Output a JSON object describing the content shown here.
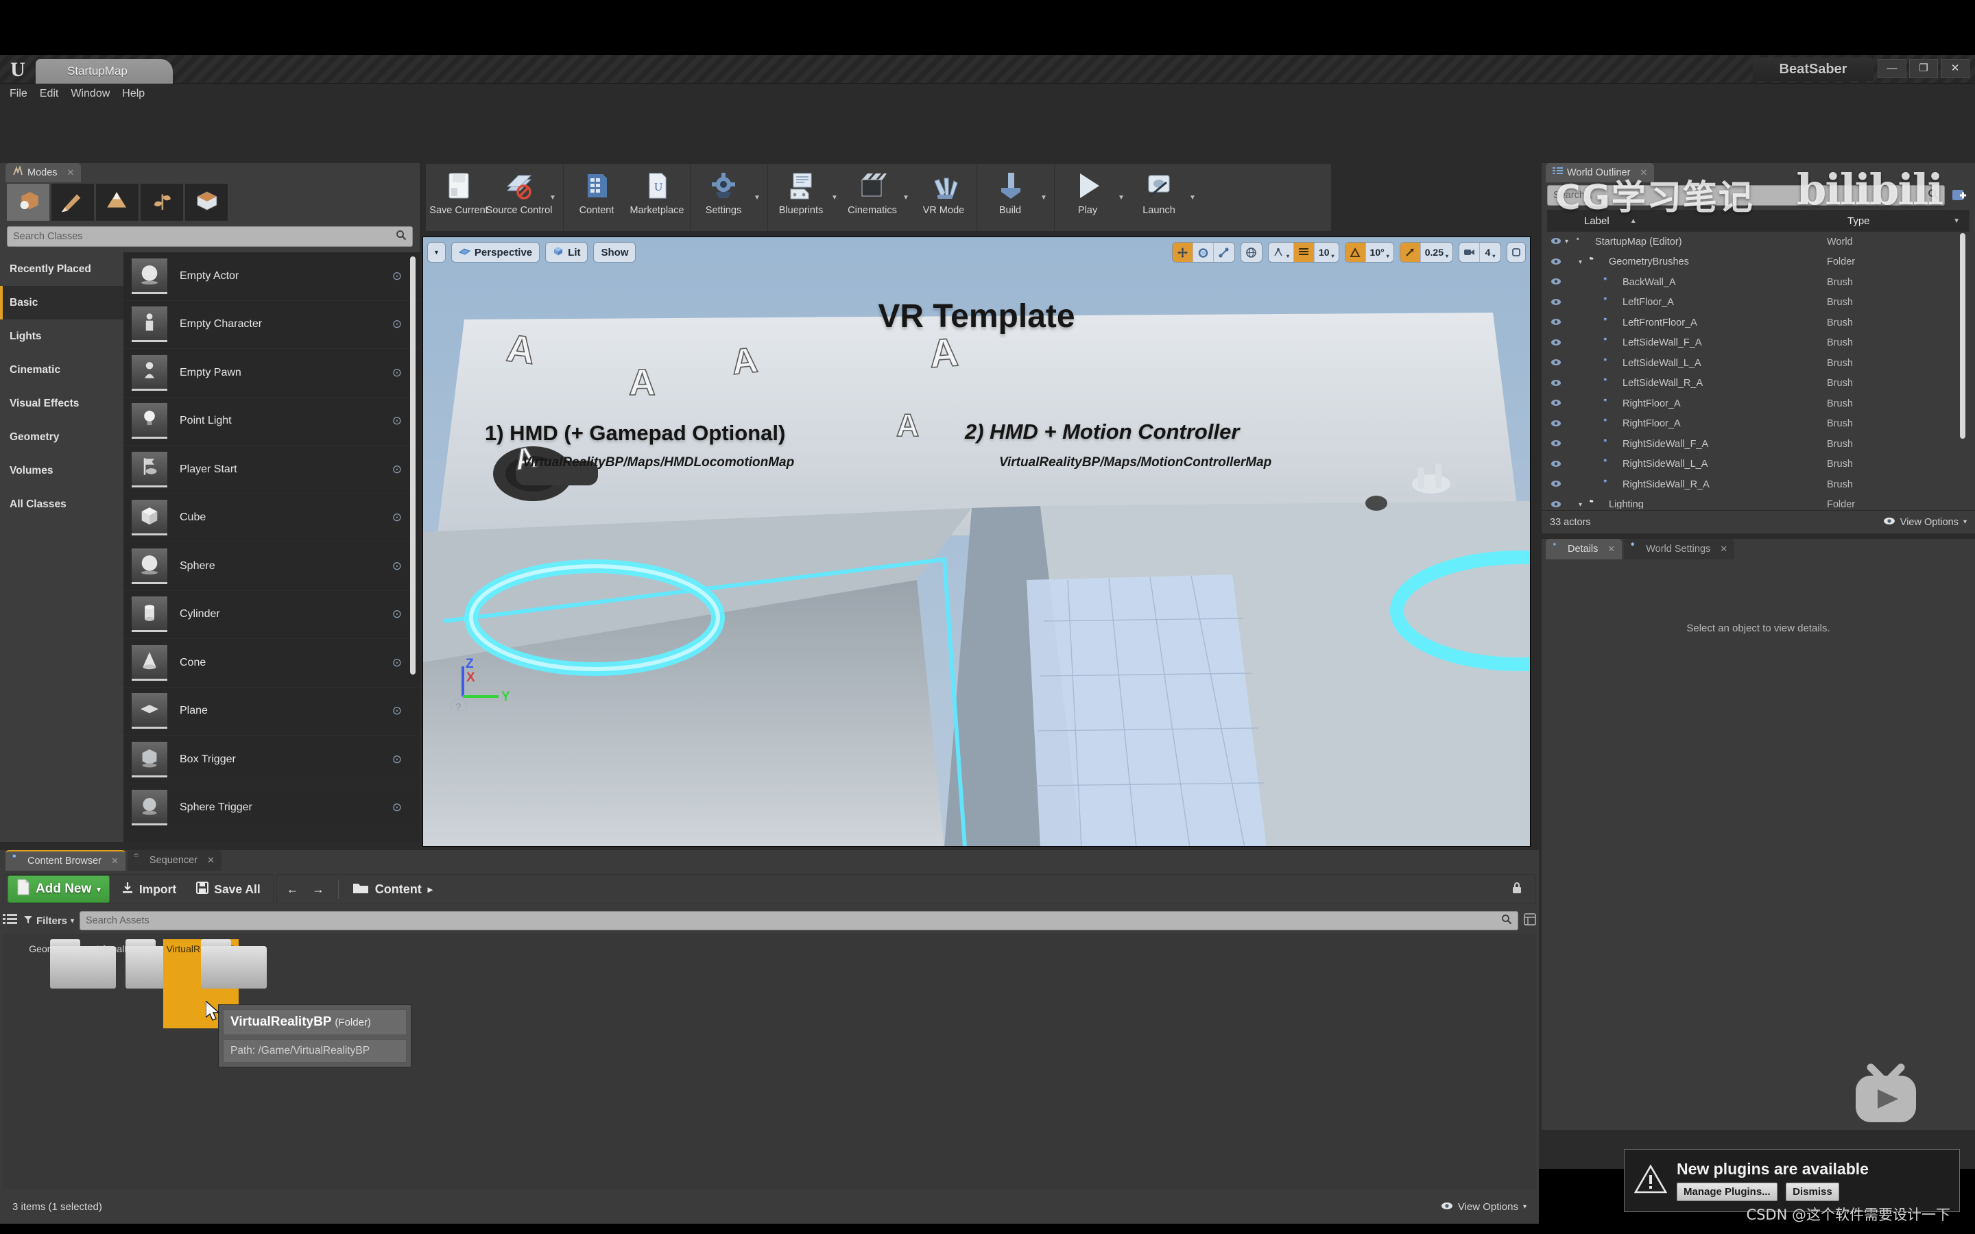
{
  "window": {
    "map_tab": "StartupMap",
    "project_name": "BeatSaber",
    "minimize": "—",
    "maximize": "❐",
    "close": "✕"
  },
  "menu": {
    "items": [
      "File",
      "Edit",
      "Window",
      "Help"
    ]
  },
  "toolbar": {
    "groups": [
      {
        "items": [
          {
            "label": "Save Current",
            "icon": "save-icon",
            "caret": false
          },
          {
            "label": "Source Control",
            "icon": "source-control-icon",
            "caret": true
          }
        ]
      },
      {
        "items": [
          {
            "label": "Content",
            "icon": "content-icon",
            "caret": false
          },
          {
            "label": "Marketplace",
            "icon": "marketplace-icon",
            "caret": false
          }
        ]
      },
      {
        "items": [
          {
            "label": "Settings",
            "icon": "gear-icon",
            "caret": true
          }
        ]
      },
      {
        "items": [
          {
            "label": "Blueprints",
            "icon": "blueprints-icon",
            "caret": true
          },
          {
            "label": "Cinematics",
            "icon": "cinematics-icon",
            "caret": true
          },
          {
            "label": "VR Mode",
            "icon": "vr-mode-icon",
            "caret": false
          }
        ]
      },
      {
        "items": [
          {
            "label": "Build",
            "icon": "build-icon",
            "caret": true
          }
        ]
      },
      {
        "items": [
          {
            "label": "Play",
            "icon": "play-icon",
            "caret": true
          },
          {
            "label": "Launch",
            "icon": "launch-icon",
            "caret": true
          }
        ]
      }
    ]
  },
  "modes": {
    "tab_label": "Modes",
    "tab_close": "✕",
    "mode_buttons": [
      "place-mode-icon",
      "paint-mode-icon",
      "landscape-mode-icon",
      "foliage-mode-icon",
      "geometry-editing-mode-icon"
    ],
    "search_placeholder": "Search Classes",
    "categories": [
      {
        "label": "Recently Placed",
        "active": false
      },
      {
        "label": "Basic",
        "active": true
      },
      {
        "label": "Lights",
        "active": false
      },
      {
        "label": "Cinematic",
        "active": false
      },
      {
        "label": "Visual Effects",
        "active": false
      },
      {
        "label": "Geometry",
        "active": false
      },
      {
        "label": "Volumes",
        "active": false
      },
      {
        "label": "All Classes",
        "active": false
      }
    ],
    "classes": [
      {
        "label": "Empty Actor",
        "icon": "sphere-thumb"
      },
      {
        "label": "Empty Character",
        "icon": "character-thumb"
      },
      {
        "label": "Empty Pawn",
        "icon": "pawn-thumb"
      },
      {
        "label": "Point Light",
        "icon": "point-light-thumb"
      },
      {
        "label": "Player Start",
        "icon": "player-start-thumb"
      },
      {
        "label": "Cube",
        "icon": "cube-thumb"
      },
      {
        "label": "Sphere",
        "icon": "sphere-thumb"
      },
      {
        "label": "Cylinder",
        "icon": "cylinder-thumb"
      },
      {
        "label": "Cone",
        "icon": "cone-thumb"
      },
      {
        "label": "Plane",
        "icon": "plane-thumb"
      },
      {
        "label": "Box Trigger",
        "icon": "box-trigger-thumb"
      },
      {
        "label": "Sphere Trigger",
        "icon": "sphere-trigger-thumb"
      }
    ],
    "help_icon": "?"
  },
  "viewport": {
    "menu_caret": "▼",
    "view_mode": "Perspective",
    "lighting_mode": "Lit",
    "show_label": "Show",
    "transform_tools": [
      "translate-tool",
      "rotate-tool",
      "scale-tool"
    ],
    "coordinate_system": "world-space-icon",
    "surface_snap_icon": "surface-snapping-icon",
    "grid_snap_icon": "grid-snap-icon",
    "grid_snap_value": "10",
    "rotation_snap_icon": "rotation-snap-icon",
    "rotation_snap_value": "10°",
    "scale_snap_icon": "scale-snap-icon",
    "scale_snap_value": "0.25",
    "camera_speed_icon": "camera-speed-icon",
    "camera_speed_value": "4",
    "maximize_icon": "maximize-viewport-icon",
    "gizmo_axes": [
      "Z",
      "X",
      "Y"
    ],
    "scene_text": {
      "title": "VR Template",
      "left_heading": "1) HMD (+ Gamepad Optional)",
      "left_path": "VirtualRealityBP/Maps/HMDLocomotionMap",
      "right_heading": "2) HMD + Motion Controller",
      "right_path": "VirtualRealityBP/Maps/MotionControllerMap"
    }
  },
  "outliner": {
    "tab_label": "World Outliner",
    "tab_close": "✕",
    "search_placeholder": "Search...",
    "add_icon": "add-actor-icon",
    "columns": {
      "label": "Label",
      "type": "Type"
    },
    "sort_caret": "▲",
    "type_caret": "▼",
    "rows": [
      {
        "label": "StartupMap (Editor)",
        "type": "World",
        "depth": 0,
        "icon": "world-icon",
        "expander": "▾"
      },
      {
        "label": "GeometryBrushes",
        "type": "Folder",
        "depth": 1,
        "icon": "folder-icon",
        "expander": "▾"
      },
      {
        "label": "BackWall_A",
        "type": "Brush",
        "depth": 2,
        "icon": "brush-icon",
        "expander": ""
      },
      {
        "label": "LeftFloor_A",
        "type": "Brush",
        "depth": 2,
        "icon": "brush-icon",
        "expander": ""
      },
      {
        "label": "LeftFrontFloor_A",
        "type": "Brush",
        "depth": 2,
        "icon": "brush-icon",
        "expander": ""
      },
      {
        "label": "LeftSideWall_F_A",
        "type": "Brush",
        "depth": 2,
        "icon": "brush-icon",
        "expander": ""
      },
      {
        "label": "LeftSideWall_L_A",
        "type": "Brush",
        "depth": 2,
        "icon": "brush-icon",
        "expander": ""
      },
      {
        "label": "LeftSideWall_R_A",
        "type": "Brush",
        "depth": 2,
        "icon": "brush-icon",
        "expander": ""
      },
      {
        "label": "RightFloor_A",
        "type": "Brush",
        "depth": 2,
        "icon": "brush-icon",
        "expander": ""
      },
      {
        "label": "RightFloor_A",
        "type": "Brush",
        "depth": 2,
        "icon": "brush-icon",
        "expander": ""
      },
      {
        "label": "RightSideWall_F_A",
        "type": "Brush",
        "depth": 2,
        "icon": "brush-icon",
        "expander": ""
      },
      {
        "label": "RightSideWall_L_A",
        "type": "Brush",
        "depth": 2,
        "icon": "brush-icon",
        "expander": ""
      },
      {
        "label": "RightSideWall_R_A",
        "type": "Brush",
        "depth": 2,
        "icon": "brush-icon",
        "expander": ""
      },
      {
        "label": "Lighting",
        "type": "Folder",
        "depth": 1,
        "icon": "folder-icon",
        "expander": "▾"
      }
    ],
    "actor_count": "33 actors",
    "view_options": "View Options",
    "view_options_caret": "▾",
    "eye_icon": "eye-icon"
  },
  "details": {
    "tabs": [
      {
        "label": "Details",
        "icon": "details-icon",
        "active": true,
        "close": "✕"
      },
      {
        "label": "World Settings",
        "icon": "world-settings-icon",
        "active": false,
        "close": "✕"
      }
    ],
    "empty_message": "Select an object to view details."
  },
  "content_browser": {
    "tabs": [
      {
        "label": "Content Browser",
        "icon": "content-browser-icon",
        "active": true,
        "close": "✕"
      },
      {
        "label": "Sequencer",
        "icon": "sequencer-icon",
        "active": false,
        "close": "✕"
      }
    ],
    "add_new": "Add New",
    "add_new_caret": "▾",
    "import": "Import",
    "save_all": "Save All",
    "back_arrow": "←",
    "forward_arrow": "→",
    "breadcrumb": "Content",
    "breadcrumb_caret": "▸",
    "lock_icon": "lock-icon",
    "sources_icon": "sources-panel-icon",
    "filters": "Filters",
    "filters_caret": "▾",
    "search_placeholder": "Search Assets",
    "search_icon": "search-icon",
    "settings_icon": "settings-icon",
    "assets": [
      {
        "label": "Geometry",
        "selected": false
      },
      {
        "label": "VirtualReality",
        "selected": false
      },
      {
        "label": "VirtualRealityBP",
        "selected": true
      }
    ],
    "status": "3 items (1 selected)",
    "view_options": "View Options",
    "view_options_caret": "▾",
    "eye_icon": "eye-icon"
  },
  "tooltip": {
    "title": "VirtualRealityBP",
    "kind": "(Folder)",
    "path": "Path: /Game/VirtualRealityBP"
  },
  "notification": {
    "warning_icon": "warning-icon",
    "title": "New plugins are available",
    "primary_button": "Manage Plugins...",
    "secondary_button": "Dismiss"
  },
  "watermarks": {
    "cg_note": "CG学习笔记",
    "bilibili": "bilibili",
    "csdn": "CSDN @这个软件需要设计一下"
  },
  "colors": {
    "accent_orange": "#e09a32",
    "add_new_green": "#4aa646",
    "selection_yellow": "#e8a317",
    "panel_bg": "#3b3b3b",
    "dark_bg": "#282828"
  }
}
